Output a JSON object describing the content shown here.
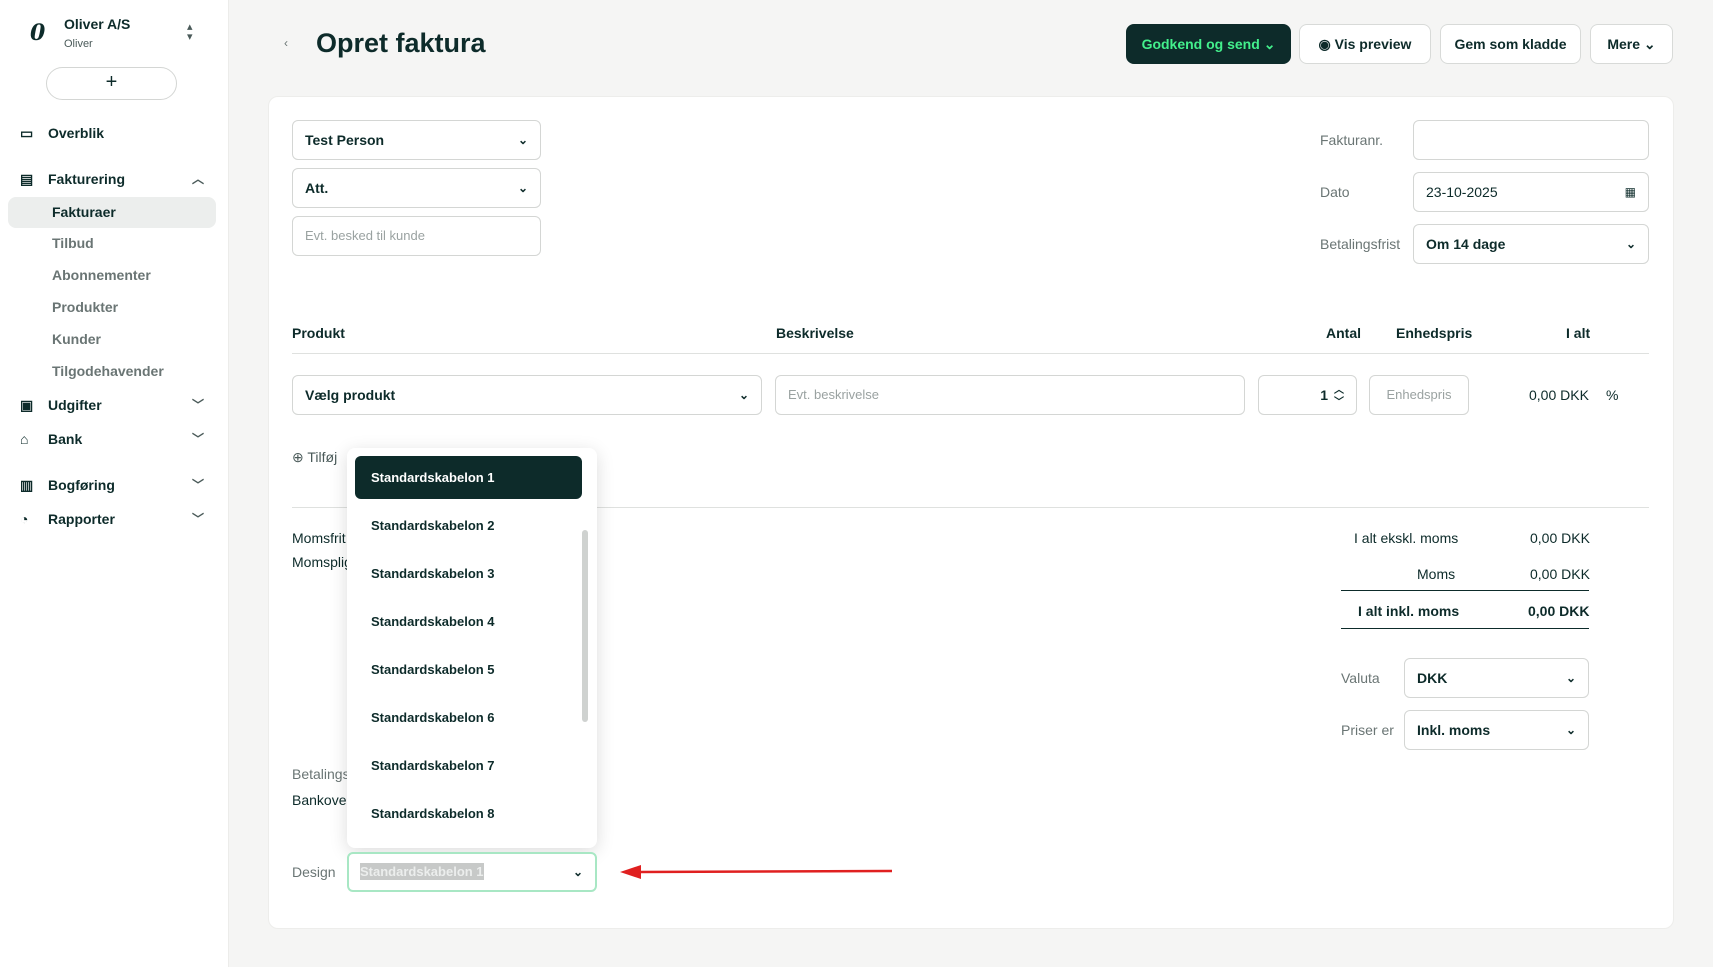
{
  "sidebar": {
    "brand": {
      "logo": "0",
      "name": "Oliver A/S",
      "user": "Oliver"
    },
    "add_label": "+",
    "overview": "Overblik",
    "invoicing": "Fakturering",
    "sub_items": [
      "Fakturaer",
      "Tilbud",
      "Abonnementer",
      "Produkter",
      "Kunder",
      "Tilgodehavender"
    ],
    "expenses": "Udgifter",
    "bank": "Bank",
    "bookkeeping": "Bogføring",
    "reports": "Rapporter"
  },
  "header": {
    "title": "Opret faktura",
    "approve_send": "Godkend og send",
    "preview": "Vis preview",
    "save_draft": "Gem som kladde",
    "more": "Mere"
  },
  "form": {
    "customer": "Test Person",
    "att": "Att.",
    "message_placeholder": "Evt. besked til kunde",
    "invoice_no_label": "Fakturanr.",
    "invoice_no_value": "",
    "date_label": "Dato",
    "date_value": "23-10-2025",
    "due_label": "Betalingsfrist",
    "due_value": "Om 14 dage"
  },
  "lines": {
    "headers": {
      "product": "Produkt",
      "description": "Beskrivelse",
      "qty": "Antal",
      "unit_price": "Enhedspris",
      "total": "I alt"
    },
    "product_select": "Vælg produkt",
    "description_placeholder": "Evt. beskrivelse",
    "qty": "1",
    "unit_price_placeholder": "Enhedspris",
    "total": "0,00 DKK",
    "percent": "%",
    "add_line": "Tilføj"
  },
  "summary": {
    "vat_free": "Momsfrit",
    "vat_liable": "Momspligt",
    "excl_label": "I alt ekskl. moms",
    "excl_value": "0,00 DKK",
    "vat_label": "Moms",
    "vat_value": "0,00 DKK",
    "incl_label": "I alt inkl. moms",
    "incl_value": "0,00 DKK",
    "currency_label": "Valuta",
    "currency_value": "DKK",
    "prices_label": "Priser er",
    "prices_value": "Inkl. moms",
    "payment_label": "Betalings",
    "bank_transfer": "Bankover"
  },
  "design": {
    "label": "Design",
    "selected": "Standardskabelon 1",
    "options": [
      "Standardskabelon 1",
      "Standardskabelon 2",
      "Standardskabelon 3",
      "Standardskabelon 4",
      "Standardskabelon 5",
      "Standardskabelon 6",
      "Standardskabelon 7",
      "Standardskabelon 8"
    ]
  },
  "colors": {
    "primary": "#0d2b2a",
    "accent": "#43f08c",
    "arrow": "#e02020"
  },
  "icons": {
    "overview": "monitor-icon",
    "invoicing": "receipt-icon",
    "expenses": "wallet-icon",
    "bank": "bank-icon",
    "bookkeeping": "book-icon",
    "reports": "pie-chart-icon"
  }
}
